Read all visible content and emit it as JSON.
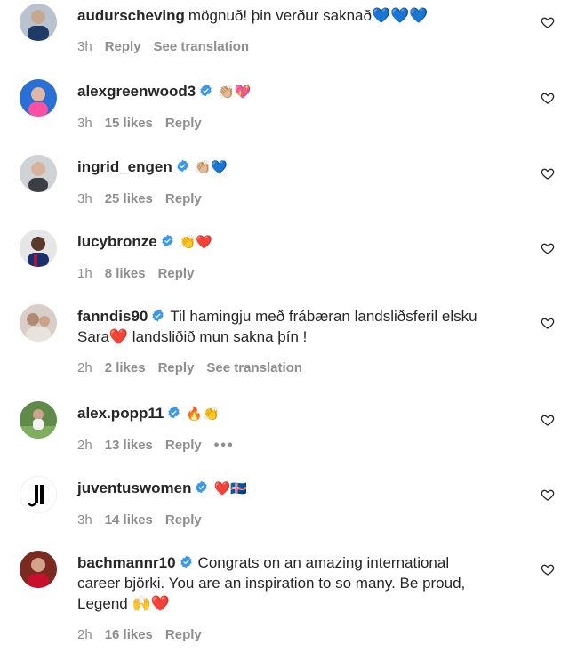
{
  "colors": {
    "text": "#262626",
    "meta": "#8e8e8e",
    "verified": "#3897f0",
    "avatar_bg": "#dcdcdc"
  },
  "icons": {
    "verified": "verified-badge-icon",
    "like": "heart-outline-icon",
    "more": "more-horizontal-icon"
  },
  "comments": [
    {
      "username": "audurscheving",
      "verified": false,
      "text": "mögnuð! þin verður saknað💙💙💙",
      "time": "3h",
      "likes": "",
      "reply": "Reply",
      "see_translation": "See translation"
    },
    {
      "username": "alexgreenwood3",
      "verified": true,
      "text": "👏🏼💖",
      "time": "3h",
      "likes": "15 likes",
      "reply": "Reply"
    },
    {
      "username": "ingrid_engen",
      "verified": true,
      "text": "👏🏼💙",
      "time": "3h",
      "likes": "25 likes",
      "reply": "Reply"
    },
    {
      "username": "lucybronze",
      "verified": true,
      "text": "👏❤️",
      "time": "1h",
      "likes": "8 likes",
      "reply": "Reply"
    },
    {
      "username": "fanndis90",
      "verified": true,
      "text_line1": "Til hamingju með frábæran landsliðsferil elsku",
      "text_line2": "Sara❤️ landsliðið mun sakna þín !",
      "time": "2h",
      "likes": "2 likes",
      "reply": "Reply",
      "see_translation": "See translation"
    },
    {
      "username": "alex.popp11",
      "verified": true,
      "text": "🔥👏",
      "time": "2h",
      "likes": "13 likes",
      "reply": "Reply",
      "more": "•••"
    },
    {
      "username": "juventuswomen",
      "verified": true,
      "text": "❤️🇮🇸",
      "time": "3h",
      "likes": "14 likes",
      "reply": "Reply"
    },
    {
      "username": "bachmannr10",
      "verified": true,
      "text_line1": "Congrats on an amazing international",
      "text_line2": "career björki. You are an inspiration to so many. Be proud,",
      "text_line3": "Legend 🙌❤️",
      "time": "2h",
      "likes": "16 likes",
      "reply": "Reply"
    }
  ]
}
